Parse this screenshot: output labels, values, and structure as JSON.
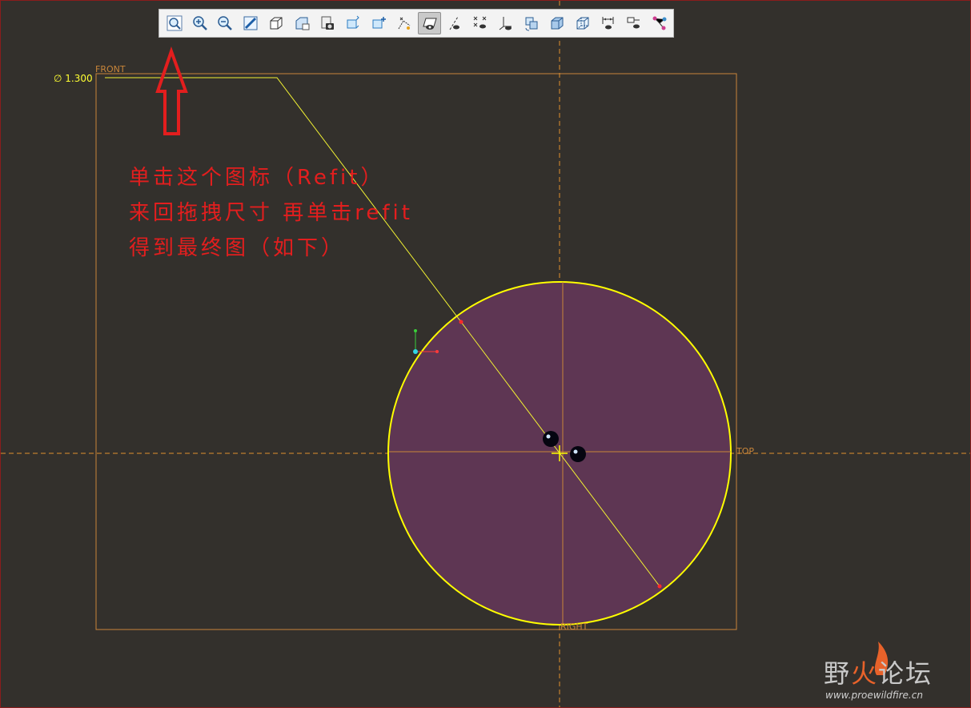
{
  "toolbar": {
    "buttons": [
      {
        "icon": "refit-zoom-icon",
        "active": false
      },
      {
        "icon": "zoom-in-icon",
        "active": false
      },
      {
        "icon": "zoom-out-icon",
        "active": false
      },
      {
        "icon": "repaint-icon",
        "active": false
      },
      {
        "icon": "display-style-icon",
        "active": false
      },
      {
        "icon": "saved-orientations-icon",
        "active": false
      },
      {
        "icon": "view-manager-icon",
        "active": false
      },
      {
        "icon": "perspective-view-icon",
        "active": false
      },
      {
        "icon": "spin-center-icon",
        "active": false
      },
      {
        "icon": "datum-display-icon",
        "active": false
      },
      {
        "icon": "sketch-orientation-icon",
        "active": true
      },
      {
        "icon": "axis-display-icon",
        "active": false
      },
      {
        "icon": "point-display-icon",
        "active": false
      },
      {
        "icon": "csys-display-icon",
        "active": false
      },
      {
        "icon": "refresh-view-icon",
        "active": false
      },
      {
        "icon": "shading-icon",
        "active": false
      },
      {
        "icon": "hidden-line-icon",
        "active": false
      },
      {
        "icon": "dimension-display-icon",
        "active": false
      },
      {
        "icon": "constraint-display-icon",
        "active": false
      },
      {
        "icon": "vertex-display-icon",
        "active": false
      }
    ]
  },
  "sketch": {
    "dimension_label": "∅ 1.300",
    "front_label": "FRONT",
    "top_label": "TOP",
    "right_label": "RIGHT",
    "circle_fill": "#5e3653",
    "circle_stroke": "#ffff00",
    "reference_color": "#c8853a"
  },
  "annotation": {
    "line1": "单击这个图标（Refit）",
    "line2": "来回拖拽尺寸 再单击refit",
    "line3": "得到最终图（如下）",
    "color": "#e31e1e"
  },
  "watermark": {
    "brand_part1": "野",
    "brand_part2": "火",
    "brand_part3": "论坛",
    "url": "www.proewildfire.cn"
  }
}
